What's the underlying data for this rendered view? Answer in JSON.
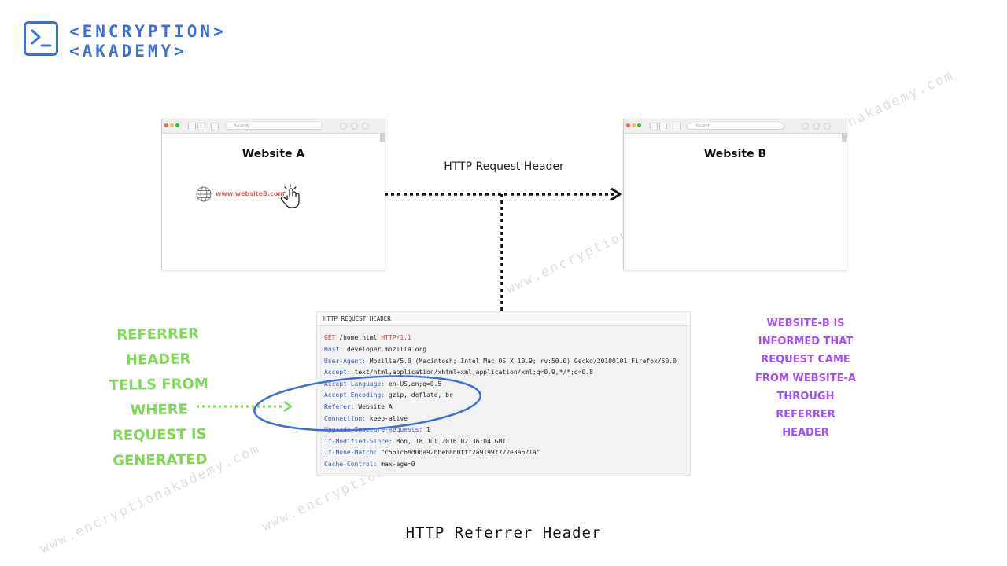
{
  "logo": {
    "line1": "<ENCRYPTION>",
    "line2": "<AKADEMY>",
    "accent": "#3b6fd9"
  },
  "browser_a": {
    "title": "Website A",
    "search_placeholder": "Search",
    "link_text": "www.websiteB.com"
  },
  "browser_b": {
    "title": "Website B",
    "search_placeholder": "Search"
  },
  "arrow_label": "HTTP Request Header",
  "http_panel": {
    "heading": "HTTP REQUEST HEADER",
    "request_line": {
      "method": "GET",
      "path": " /home.html ",
      "version": "HTTP/1.1"
    },
    "lines": [
      {
        "key": "Host:",
        "value": " developer.mozilla.org"
      },
      {
        "key": "User-Agent:",
        "value": " Mozilla/5.0 (Macintosh; Intel Mac OS X 10.9; rv:50.0) Gecko/20100101 Firefox/50.0"
      },
      {
        "key": "Accept:",
        "value": " text/html,application/xhtml+xml,application/xml;q=0.9,*/*;q=0.8"
      },
      {
        "key": "Accept-Language:",
        "value": " en-US,en;q=0.5"
      },
      {
        "key": "Accept-Encoding:",
        "value": " gzip, deflate, br"
      },
      {
        "key": "Referer:",
        "value": " Website A"
      },
      {
        "key": "Connection:",
        "value": " keep-alive"
      },
      {
        "key": "Upgrade-Insecure-Requests:",
        "value": " 1"
      },
      {
        "key": "If-Modified-Since:",
        "value": " Mon, 18 Jul 2016 02:36:04 GMT"
      },
      {
        "key": "If-None-Match:",
        "value": " \"c561c68d0ba92bbeb8b0fff2a9199f722e3a621a\""
      },
      {
        "key": "Cache-Control:",
        "value": " max-age=0"
      }
    ]
  },
  "left_note": [
    "REFERRER",
    "HEADER",
    "TELLS FROM",
    "WHERE",
    "REQUEST IS",
    "GENERATED"
  ],
  "right_note": [
    "WEBSITE-B IS",
    "INFORMED THAT",
    "REQUEST CAME",
    "FROM WEBSITE-A",
    "THROUGH",
    "REFERRER",
    "HEADER"
  ],
  "caption": "HTTP Referrer Header",
  "watermark": "www.encryptionakademy.com",
  "colors": {
    "green_note": "#7ed957",
    "purple_note": "#a24dff",
    "highlight_ellipse": "#3b6fd9",
    "link": "#e06767"
  }
}
